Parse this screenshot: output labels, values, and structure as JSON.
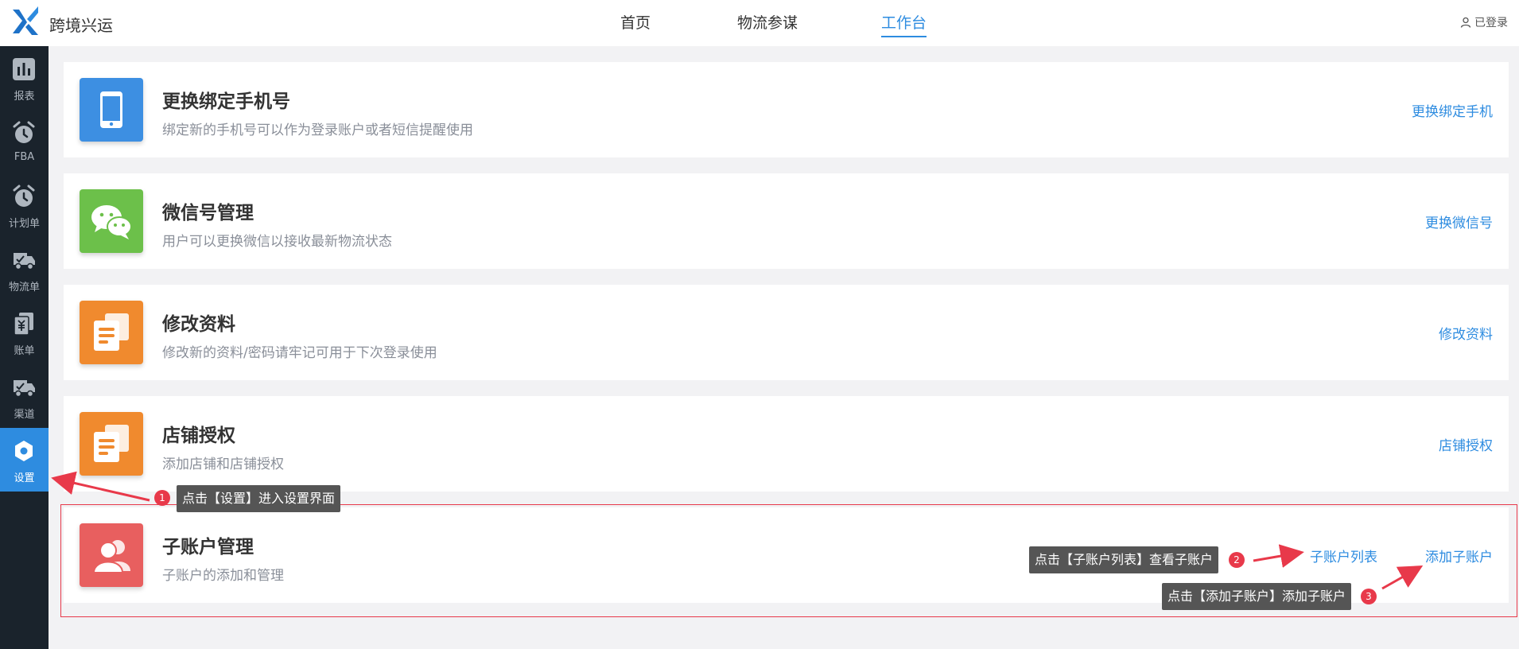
{
  "header": {
    "brand": "跨境兴运",
    "nav": [
      {
        "label": "首页"
      },
      {
        "label": "物流参谋"
      },
      {
        "label": "工作台"
      }
    ],
    "active_nav": "工作台",
    "user_label": "已登录"
  },
  "sidebar": {
    "items": [
      {
        "label": "报表",
        "icon": "bar-chart-icon"
      },
      {
        "label": "FBA",
        "icon": "alarm-clock-icon"
      },
      {
        "label": "计划单",
        "icon": "alarm-clock-icon"
      },
      {
        "label": "物流单",
        "icon": "truck-icon"
      },
      {
        "label": "账单",
        "icon": "bill-icon"
      },
      {
        "label": "渠道",
        "icon": "truck-icon"
      },
      {
        "label": "设置",
        "icon": "gear-icon"
      }
    ],
    "active": "设置"
  },
  "cards": [
    {
      "title": "更换绑定手机号",
      "desc": "绑定新的手机号可以作为登录账户或者短信提醒使用",
      "action": "更换绑定手机",
      "icon": "phone-icon",
      "color": "#3d8fe2"
    },
    {
      "title": "微信号管理",
      "desc": "用户可以更换微信以接收最新物流状态",
      "action": "更换微信号",
      "icon": "wechat-icon",
      "color": "#6cc04a"
    },
    {
      "title": "修改资料",
      "desc": "修改新的资料/密码请牢记可用于下次登录使用",
      "action": "修改资料",
      "icon": "documents-icon",
      "color": "#f08a2e"
    },
    {
      "title": "店铺授权",
      "desc": "添加店铺和店铺授权",
      "action": "店铺授权",
      "icon": "documents-icon",
      "color": "#f08a2e"
    },
    {
      "title": "子账户管理",
      "desc": "子账户的添加和管理",
      "action": "添加子账户",
      "action2": "子账户列表",
      "icon": "users-icon",
      "color": "#e85f5f"
    }
  ],
  "annotations": [
    {
      "num": "1",
      "text": "点击【设置】进入设置界面"
    },
    {
      "num": "2",
      "text": "点击【子账户列表】查看子账户"
    },
    {
      "num": "3",
      "text": "点击【添加子账户】添加子账户"
    }
  ],
  "colors": {
    "accent": "#2e8ce0",
    "sidebar_bg": "#1a232c",
    "highlight": "#e8394a"
  }
}
